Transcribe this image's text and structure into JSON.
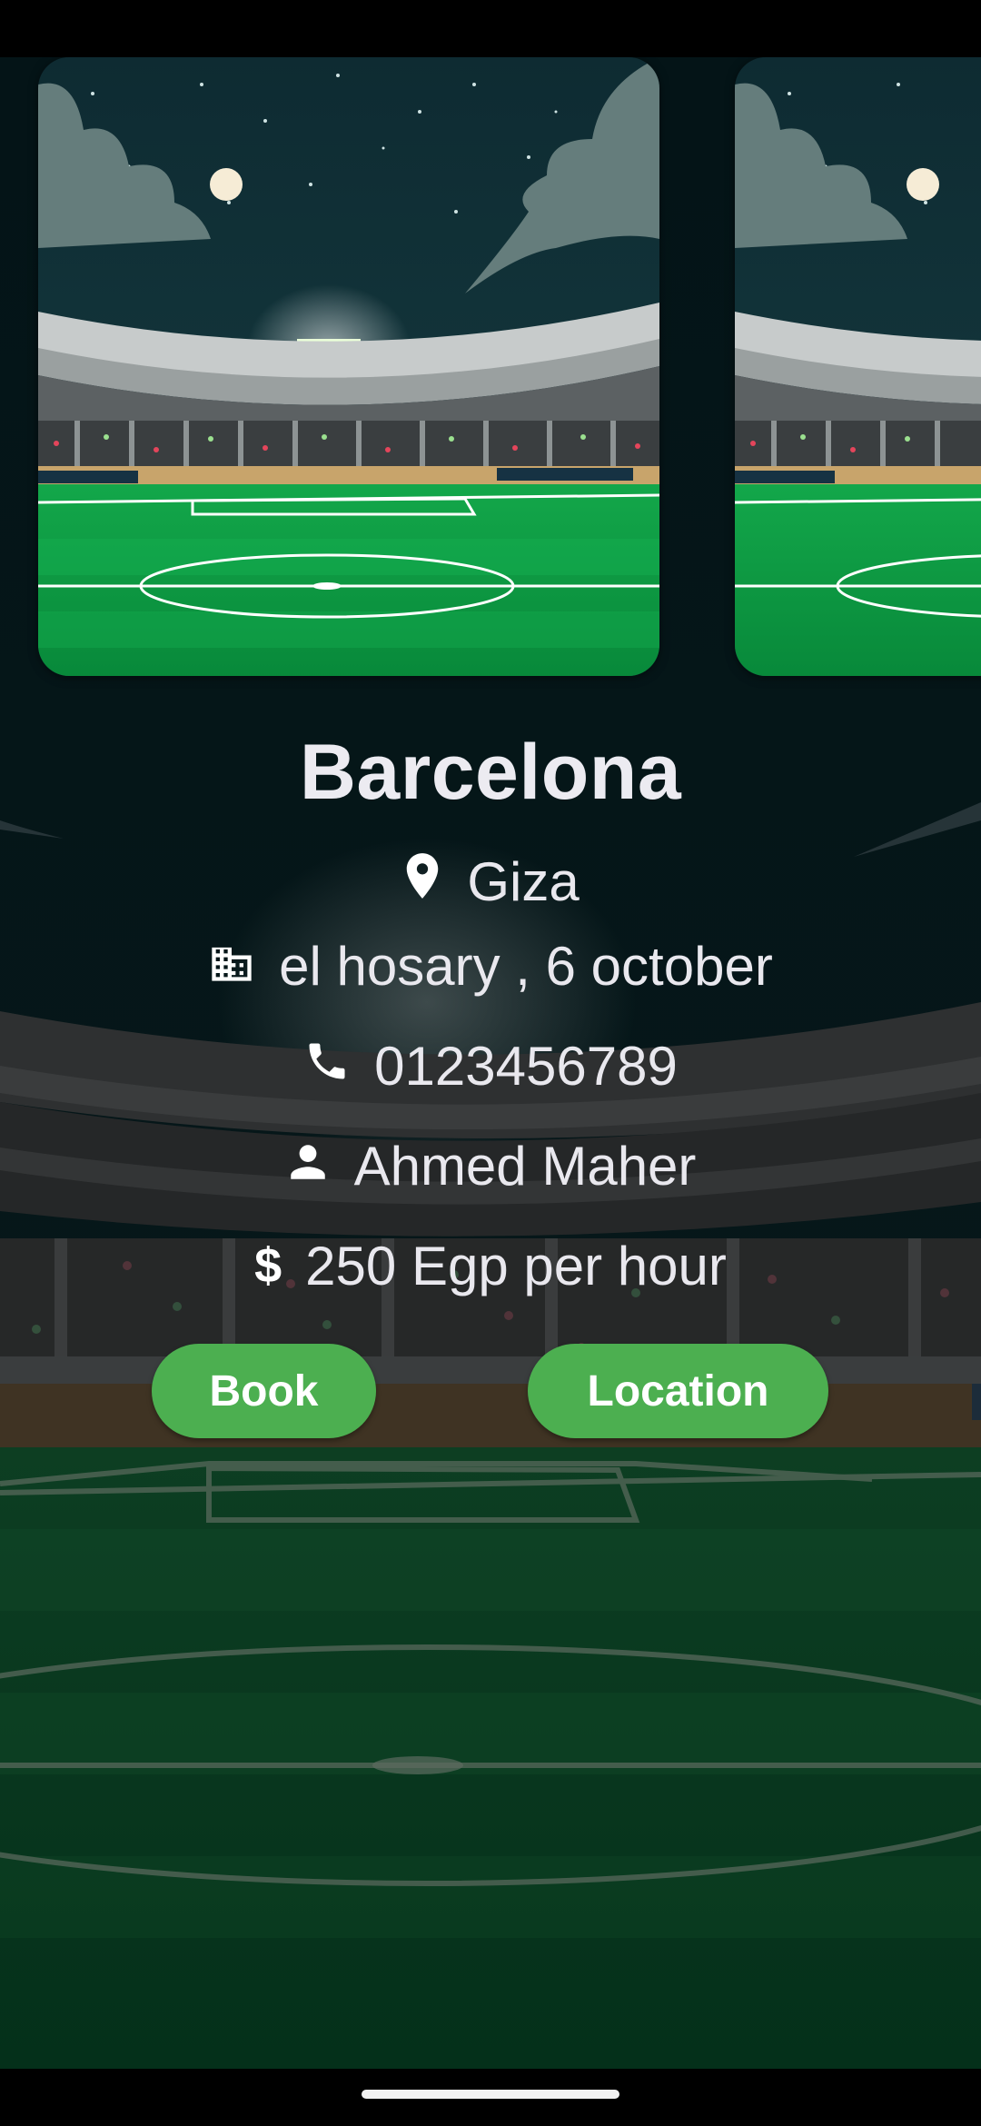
{
  "stadium": {
    "name": "Barcelona",
    "city": "Giza",
    "address": "el hosary , 6 october",
    "phone": "0123456789",
    "owner": "Ahmed Maher",
    "price": "250 Egp per hour"
  },
  "actions": {
    "book_label": "Book",
    "location_label": "Location"
  },
  "icons": {
    "city": "location-pin-icon",
    "address": "building-icon",
    "phone": "phone-icon",
    "owner": "person-icon",
    "price": "dollar-icon"
  },
  "colors": {
    "accent": "#4caf50",
    "text": "#ecebf1",
    "sky": "#0d2a2f",
    "pitch": "#0a9a3e"
  }
}
